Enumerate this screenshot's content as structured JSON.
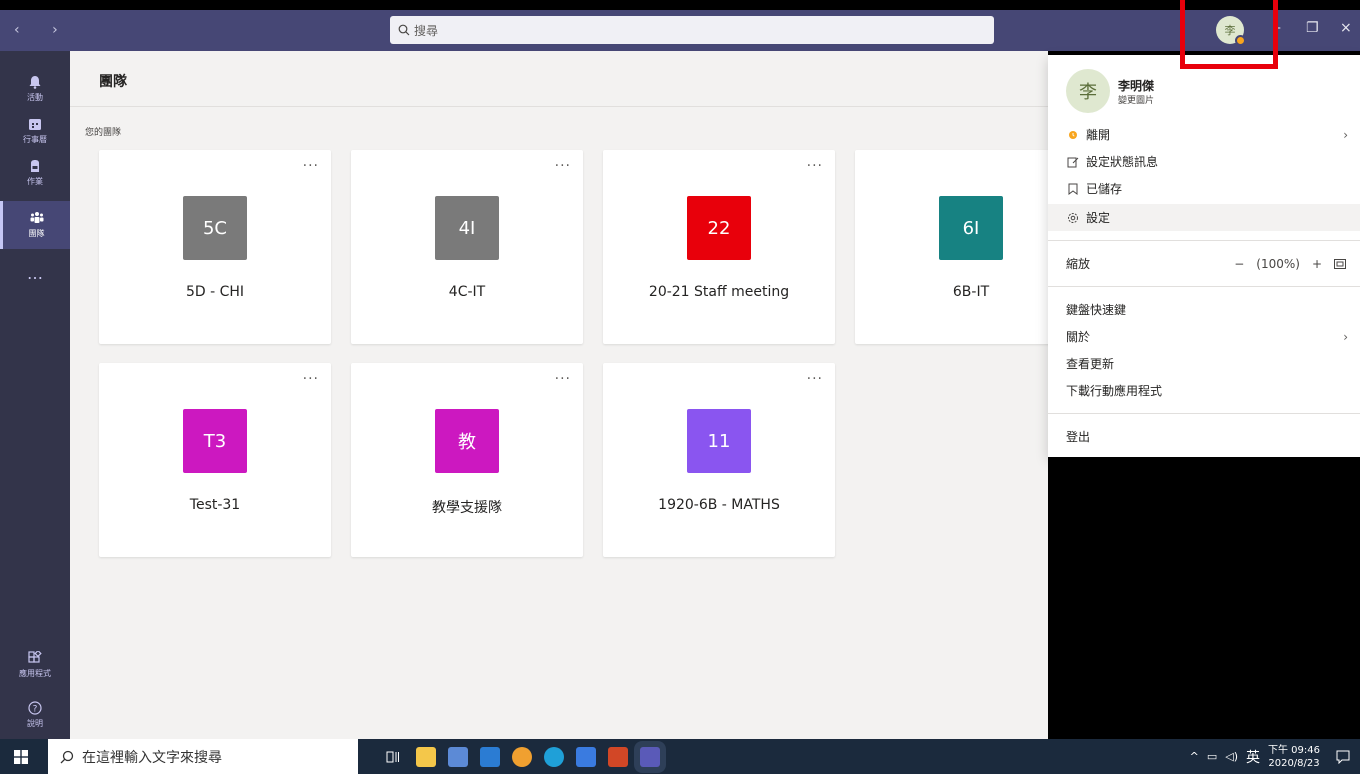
{
  "titlebar": {
    "search_placeholder": "搜尋",
    "avatar_initial": "李",
    "back": "‹",
    "forward": "›",
    "minimize": "–",
    "maximize": "❐",
    "close": "×"
  },
  "rail": {
    "items": [
      {
        "label": "活動",
        "icon": "bell-icon"
      },
      {
        "label": "行事曆",
        "icon": "calendar-icon"
      },
      {
        "label": "作業",
        "icon": "backpack-icon"
      },
      {
        "label": "團隊",
        "icon": "teams-icon"
      },
      {
        "label": "…",
        "icon": "more-icon"
      }
    ],
    "bottom": [
      {
        "label": "應用程式",
        "icon": "apps-icon"
      },
      {
        "label": "說明",
        "icon": "help-icon"
      }
    ]
  },
  "main": {
    "title": "團隊",
    "section_label": "您的團隊",
    "teams": [
      {
        "tile": "5C",
        "name": "5D - CHI",
        "color": "#7a7a7a"
      },
      {
        "tile": "4I",
        "name": "4C-IT",
        "color": "#7a7a7a"
      },
      {
        "tile": "22",
        "name": "20-21 Staff meeting",
        "color": "#e8000b"
      },
      {
        "tile": "6I",
        "name": "6B-IT",
        "color": "#178282"
      },
      {
        "tile": "T3",
        "name": "Test-31",
        "color": "#cc18c0"
      },
      {
        "tile": "教",
        "name": "教學支援隊",
        "color": "#cc18c0"
      },
      {
        "tile": "11",
        "name": "1920-6B - MATHS",
        "color": "#8a55f0"
      }
    ],
    "more_label": "···"
  },
  "profile_menu": {
    "avatar_initial": "李",
    "username": "李明傑",
    "change_photo": "變更圖片",
    "status": "離開",
    "set_status_message": "設定狀態訊息",
    "saved": "已儲存",
    "settings": "設定",
    "zoom_label": "縮放",
    "zoom_minus": "−",
    "zoom_value": "(100%)",
    "zoom_plus": "+",
    "shortcuts": "鍵盤快速鍵",
    "about": "關於",
    "check_updates": "查看更新",
    "download_mobile": "下載行動應用程式",
    "sign_out": "登出",
    "chevron": "›"
  },
  "taskbar": {
    "search_placeholder": "在這裡輸入文字來搜尋",
    "ime": "英",
    "time": "下午 09:46",
    "date": "2020/8/23"
  },
  "colors": {
    "titlebar": "#464775",
    "rail": "#33344a",
    "highlight": "#e8000b",
    "status_away": "#f8a51e"
  }
}
